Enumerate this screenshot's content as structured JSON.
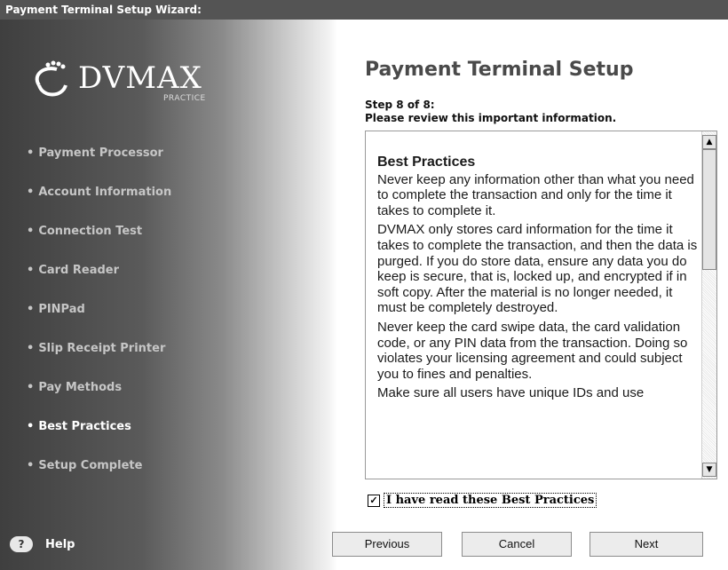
{
  "window": {
    "title": "Payment Terminal Setup Wizard:"
  },
  "logo": {
    "name": "DVMAX",
    "sub": "PRACTICE"
  },
  "nav": [
    {
      "label": "Payment Processor",
      "active": false
    },
    {
      "label": "Account Information",
      "active": false
    },
    {
      "label": "Connection Test",
      "active": false
    },
    {
      "label": "Card Reader",
      "active": false
    },
    {
      "label": "PINPad",
      "active": false
    },
    {
      "label": "Slip Receipt Printer",
      "active": false
    },
    {
      "label": "Pay Methods",
      "active": false
    },
    {
      "label": "Best Practices",
      "active": true
    },
    {
      "label": "Setup Complete",
      "active": false
    }
  ],
  "main": {
    "title": "Payment Terminal Setup",
    "step": "Step 8 of 8:",
    "instruction": "Please review this important information."
  },
  "content": {
    "heading": "Best Practices",
    "paragraphs": [
      "Never keep any information other than what you need to complete the transaction and only for the time it takes to complete it.",
      "DVMAX only stores card information for the time it takes to complete the transaction, and then the data is purged. If you do store data, ensure any data you do keep is secure, that is, locked up, and encrypted if in soft copy. After the material is no longer needed, it must be completely destroyed.",
      "Never keep the card swipe data, the card validation code, or any PIN data from the transaction. Doing so violates your licensing agreement and could subject you to fines and penalties.",
      "Make sure all users have unique IDs and use"
    ]
  },
  "checkbox": {
    "label": "I have read these Best Practices",
    "checked": true,
    "mark": "✓"
  },
  "footer": {
    "help": "Help",
    "help_icon": "?",
    "previous": "Previous",
    "cancel": "Cancel",
    "next": "Next"
  },
  "icons": {
    "scroll_up": "▲",
    "scroll_down": "▼"
  }
}
